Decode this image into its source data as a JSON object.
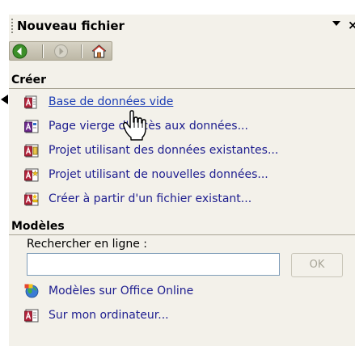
{
  "task_pane": {
    "title": "Nouveau fichier",
    "menu_icon": "dropdown-arrow-icon",
    "close_glyph": "×"
  },
  "nav_toolbar": {
    "back_icon": "back-arrow-icon",
    "forward_icon": "forward-arrow-icon",
    "home_icon": "home-icon"
  },
  "create_section": {
    "header": "Créer",
    "items": [
      {
        "label": "Base de données vide",
        "icon": "blank-database-icon"
      },
      {
        "label": "Page vierge d'accès aux données...",
        "icon": "data-access-page-icon"
      },
      {
        "label": "Projet utilisant des données existantes...",
        "icon": "project-existing-data-icon"
      },
      {
        "label": "Projet utilisant de nouvelles données...",
        "icon": "project-new-data-icon"
      },
      {
        "label": "Créer à partir d'un fichier existant...",
        "icon": "from-existing-file-icon"
      }
    ]
  },
  "templates_section": {
    "header": "Modèles",
    "search_label": "Rechercher en ligne :",
    "search_value": "",
    "ok_label": "OK",
    "items": [
      {
        "label": "Modèles sur Office Online",
        "icon": "office-online-icon"
      },
      {
        "label": "Sur mon ordinateur...",
        "icon": "my-computer-templates-icon"
      }
    ]
  },
  "colors": {
    "pane_background": "#f3f1ea",
    "link_text": "#1d1d8f",
    "active_link": "#1b3db5",
    "back_button": "#3d8f2a",
    "disabled_button": "#a7a497"
  }
}
